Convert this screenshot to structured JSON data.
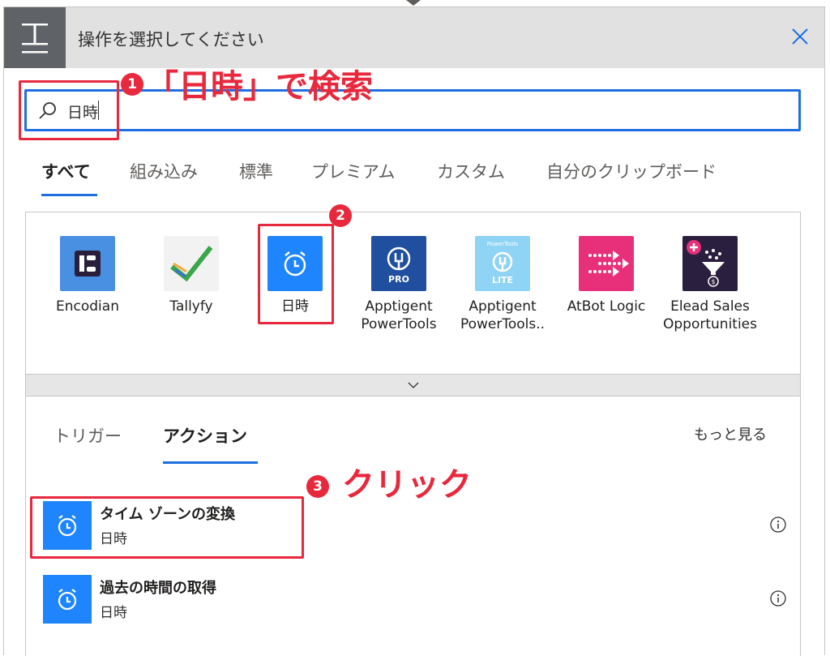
{
  "header": {
    "title": "操作を選択してください",
    "close_icon": "close-icon"
  },
  "search": {
    "value": "日時",
    "icon": "search-icon"
  },
  "filter_tabs": [
    {
      "label": "すべて",
      "active": true
    },
    {
      "label": "組み込み",
      "active": false
    },
    {
      "label": "標準",
      "active": false
    },
    {
      "label": "プレミアム",
      "active": false
    },
    {
      "label": "カスタム",
      "active": false
    },
    {
      "label": "自分のクリップボード",
      "active": false
    }
  ],
  "connectors": [
    {
      "label": "Encodian",
      "color": "#4a90e2"
    },
    {
      "label": "Tallyfy",
      "color": "#f2f2f2"
    },
    {
      "label": "日時",
      "color": "#1f85ff"
    },
    {
      "label": "Apptigent PowerTools",
      "color": "#1f4f9e",
      "badge": "PRO"
    },
    {
      "label": "Apptigent PowerTools..",
      "color": "#8fd3f5",
      "badge": "LITE",
      "top_text": "PowerTools"
    },
    {
      "label": "AtBot Logic",
      "color": "#e8307a"
    },
    {
      "label": "Elead Sales Opportunities",
      "color": "#2b1f3f"
    }
  ],
  "sub_tabs": [
    {
      "label": "トリガー",
      "active": false
    },
    {
      "label": "アクション",
      "active": true
    }
  ],
  "see_more": "もっと見る",
  "actions": [
    {
      "title": "タイム ゾーンの変換",
      "subtitle": "日時"
    },
    {
      "title": "過去の時間の取得",
      "subtitle": "日時"
    }
  ],
  "annotations": {
    "step1": {
      "number": "1",
      "text": "「日時」で検索"
    },
    "step2": {
      "number": "2"
    },
    "step3": {
      "number": "3",
      "text": "クリック"
    }
  },
  "colors": {
    "accent": "#1f6fe0",
    "annotation_red": "#e8283c",
    "header_bg": "#e1e1e1",
    "header_icon_bg": "#5f6266"
  }
}
